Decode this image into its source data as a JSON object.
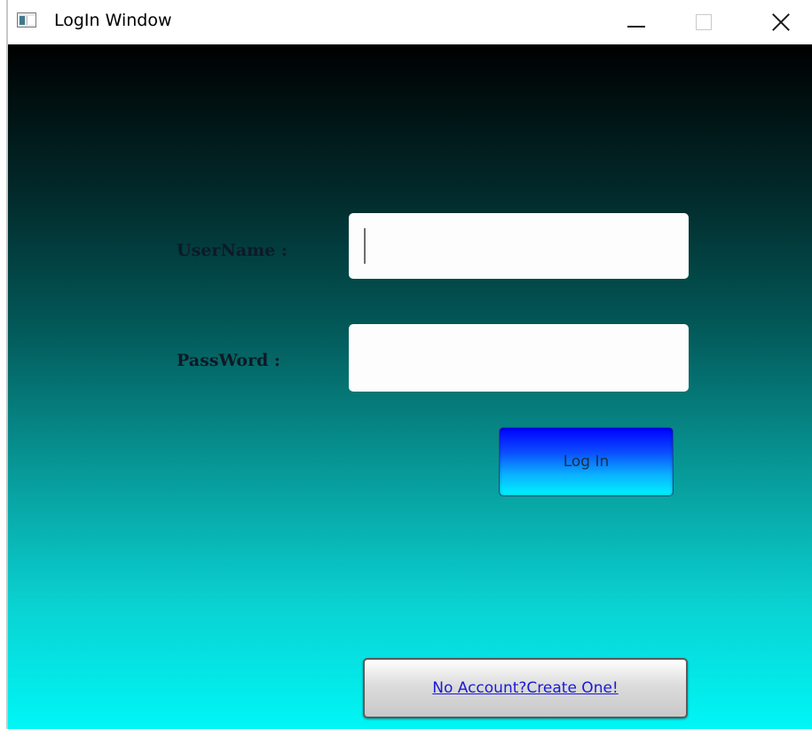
{
  "window": {
    "title": "LogIn Window",
    "icon": "app-window-icon"
  },
  "title_controls": {
    "minimize": "minimize-icon",
    "maximize": "maximize-icon",
    "close": "close-icon"
  },
  "form": {
    "username_label": "UserName :",
    "username_value": "",
    "password_label": "PassWord :",
    "password_value": "",
    "login_label": "Log In",
    "create_account_label": "No Account?Create One!"
  },
  "colors": {
    "background_gradient_top": "#000000",
    "background_gradient_bottom": "#00f6f6",
    "login_button_top": "#0000ff",
    "login_button_bottom": "#00f3ff",
    "link_color": "#1a1ad6"
  }
}
